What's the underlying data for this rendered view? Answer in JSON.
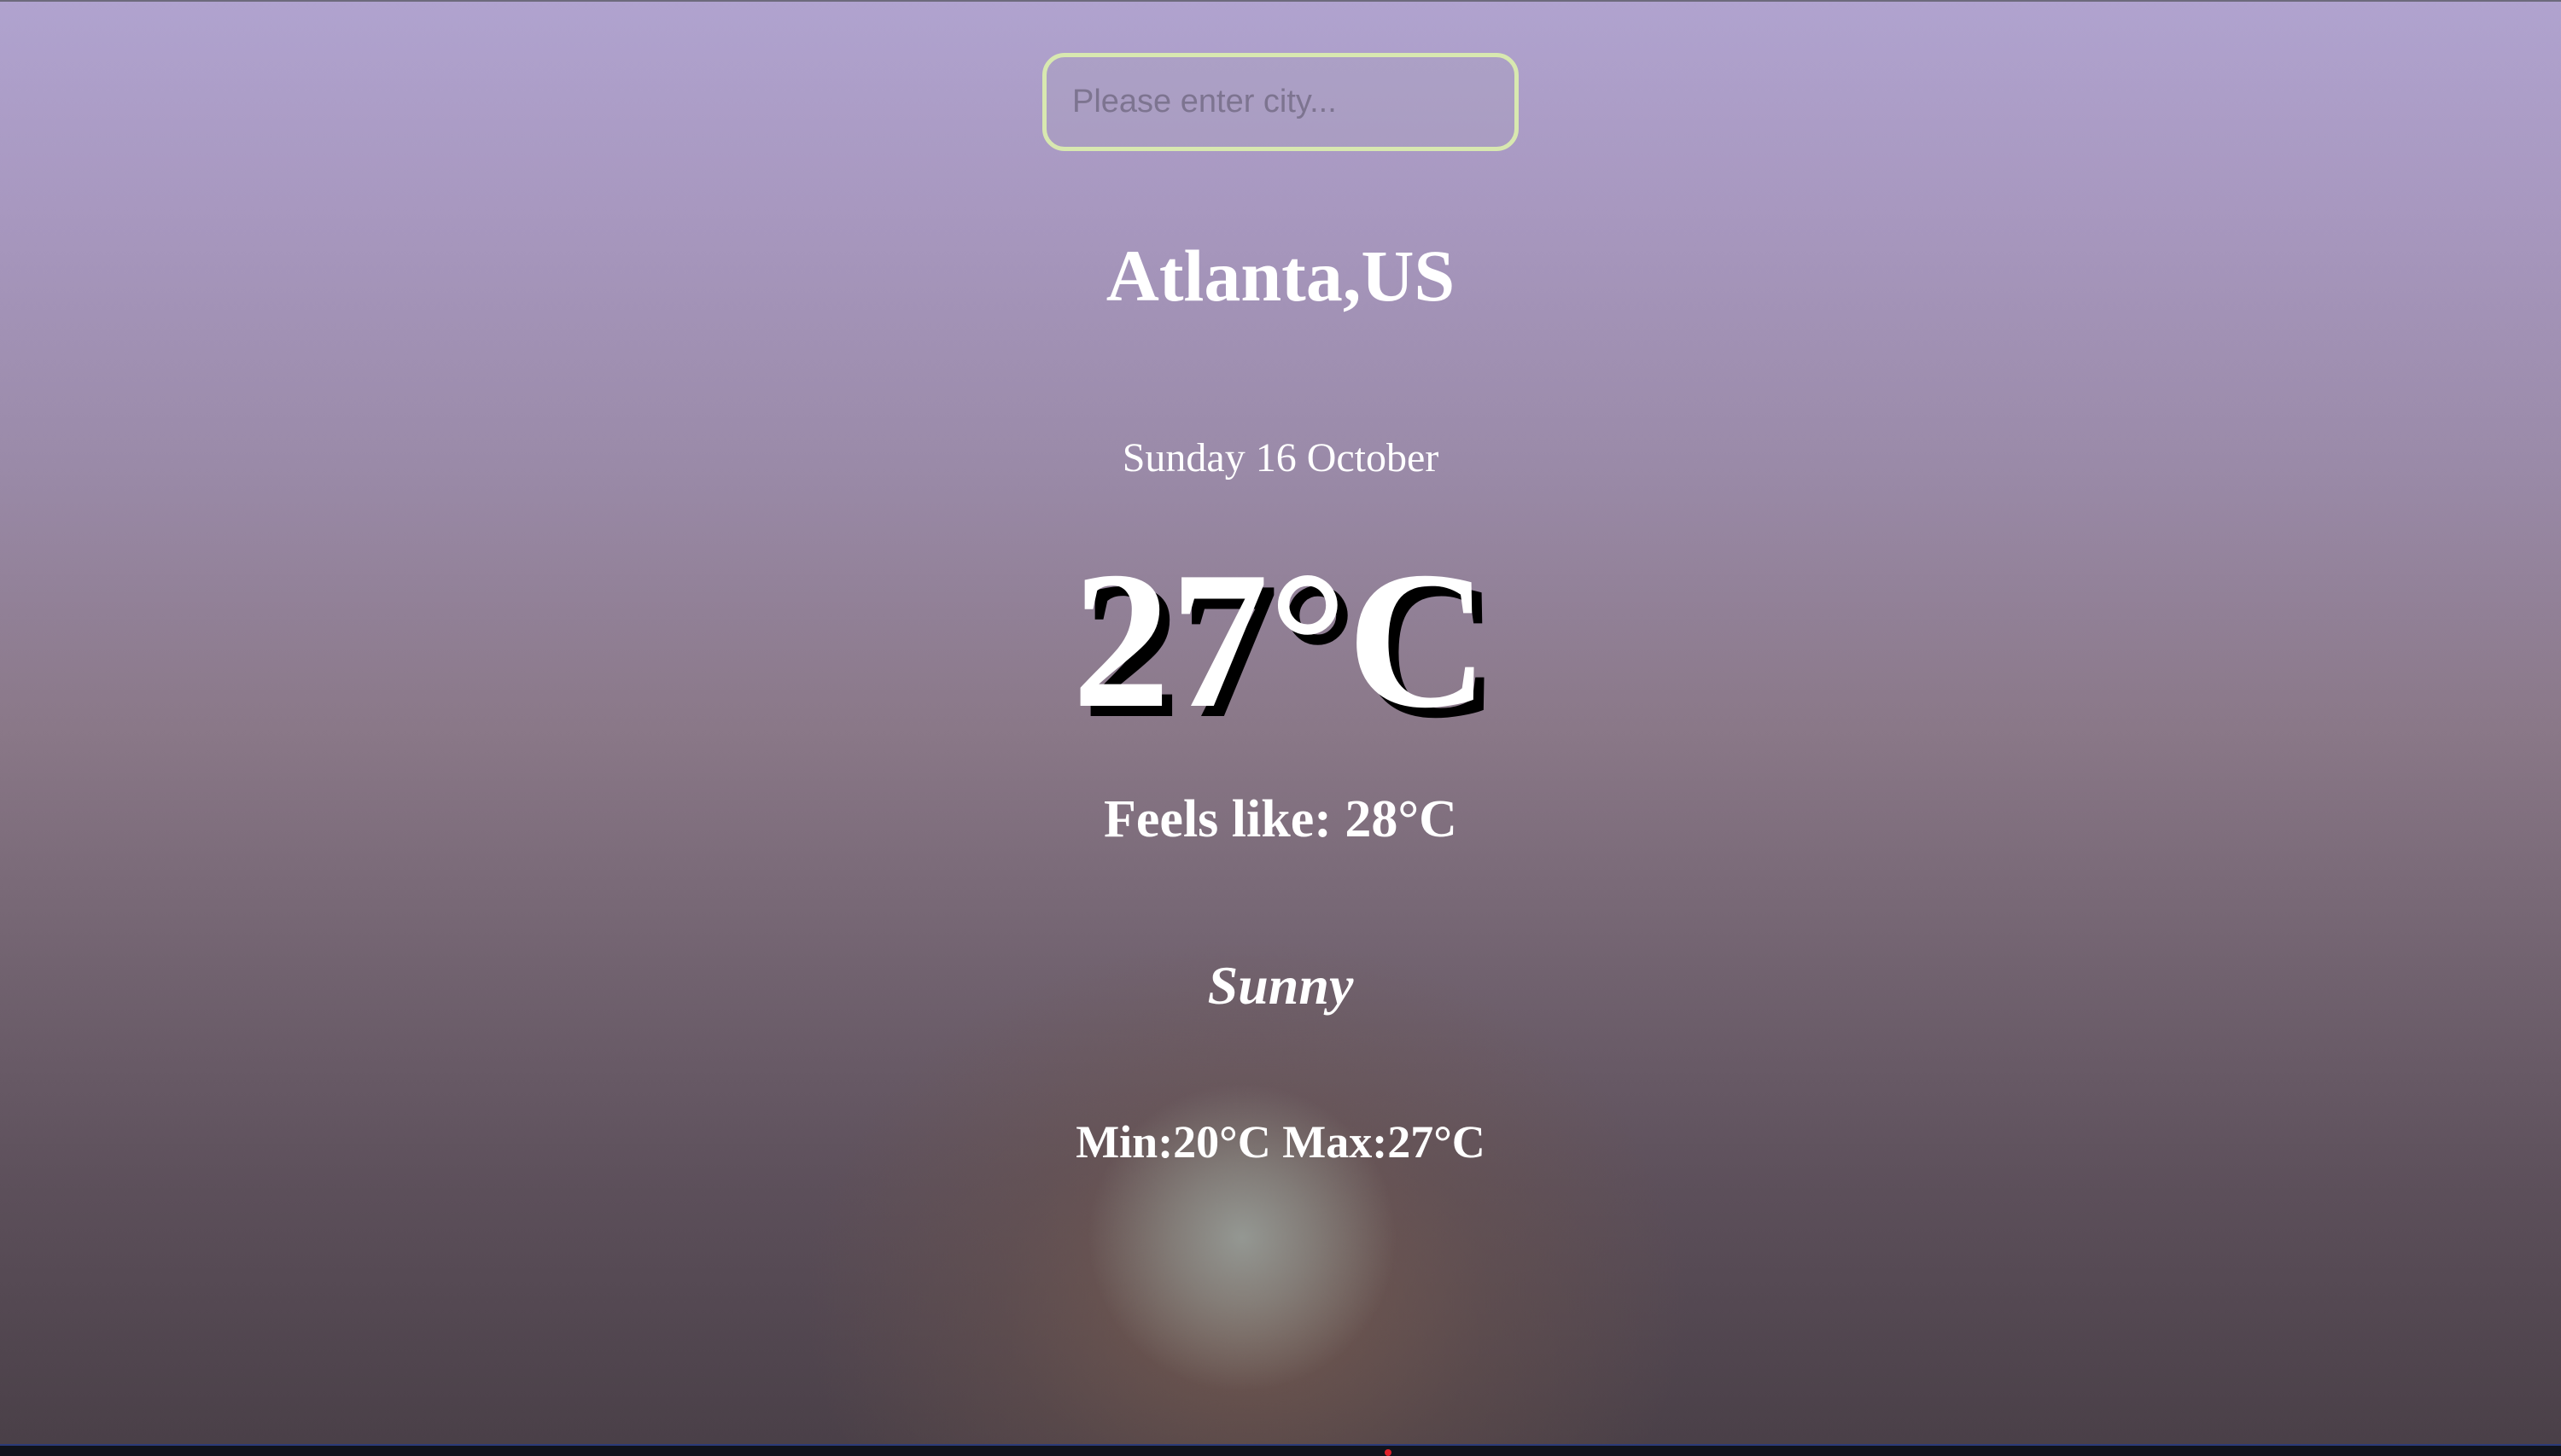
{
  "search": {
    "placeholder": "Please enter city...",
    "value": ""
  },
  "weather": {
    "location": "Atlanta,US",
    "date": "Sunday 16 October",
    "temperature": "27°C",
    "feels_like": "Feels like: 28°C",
    "condition": "Sunny",
    "min_max": "Min:20°C Max:27°C"
  },
  "colors": {
    "search_border": "#d8e8b0",
    "text": "#ffffff",
    "temperature_shadow": "#000000",
    "background_top": "#b0a3cf",
    "background_bottom": "#493f47"
  }
}
